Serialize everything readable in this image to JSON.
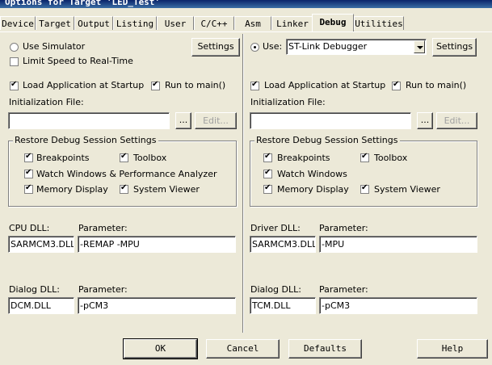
{
  "window": {
    "title": "Options for Target 'LED_Test'"
  },
  "tabs": [
    "Device",
    "Target",
    "Output",
    "Listing",
    "User",
    "C/C++",
    "Asm",
    "Linker",
    "Debug",
    "Utilities"
  ],
  "left": {
    "use_simulator": "Use Simulator",
    "limit_speed": "Limit Speed to Real-Time",
    "settings": "Settings",
    "load_app": "Load Application at Startup",
    "run_to_main": "Run to main()",
    "init_file_label": "Initialization File:",
    "init_file_value": "",
    "browse": "...",
    "edit": "Edit...",
    "restore_title": "Restore Debug Session Settings",
    "breakpoints": "Breakpoints",
    "toolbox": "Toolbox",
    "watch_windows": "Watch Windows & Performance Analyzer",
    "memory_display": "Memory Display",
    "system_viewer": "System Viewer",
    "cpu_dll_label": "CPU DLL:",
    "cpu_dll_value": "SARMCM3.DLL",
    "cpu_param_label": "Parameter:",
    "cpu_param_value": "-REMAP -MPU",
    "dialog_dll_label": "Dialog DLL:",
    "dialog_dll_value": "DCM.DLL",
    "dialog_param_label": "Parameter:",
    "dialog_param_value": "-pCM3"
  },
  "right": {
    "use": "Use:",
    "debugger": "ST-Link Debugger",
    "settings": "Settings",
    "load_app": "Load Application at Startup",
    "run_to_main": "Run to main()",
    "init_file_label": "Initialization File:",
    "init_file_value": "",
    "browse": "...",
    "edit": "Edit...",
    "restore_title": "Restore Debug Session Settings",
    "breakpoints": "Breakpoints",
    "toolbox": "Toolbox",
    "watch_windows": "Watch Windows",
    "memory_display": "Memory Display",
    "system_viewer": "System Viewer",
    "driver_dll_label": "Driver DLL:",
    "driver_dll_value": "SARMCM3.DLL",
    "driver_param_label": "Parameter:",
    "driver_param_value": "-MPU",
    "dialog_dll_label": "Dialog DLL:",
    "dialog_dll_value": "TCM.DLL",
    "dialog_param_label": "Parameter:",
    "dialog_param_value": "-pCM3"
  },
  "buttons": {
    "ok": "OK",
    "cancel": "Cancel",
    "defaults": "Defaults",
    "help": "Help"
  },
  "checks": {
    "left_use_simulator": false,
    "left_limit_speed": false,
    "left_load_app": true,
    "left_run_to_main": true,
    "left_breakpoints": true,
    "left_toolbox": true,
    "left_watch": true,
    "left_memory": true,
    "left_sysviewer": true,
    "right_use": true,
    "right_load_app": true,
    "right_run_to_main": true,
    "right_breakpoints": true,
    "right_toolbox": true,
    "right_watch": true,
    "right_memory": true,
    "right_sysviewer": true
  }
}
